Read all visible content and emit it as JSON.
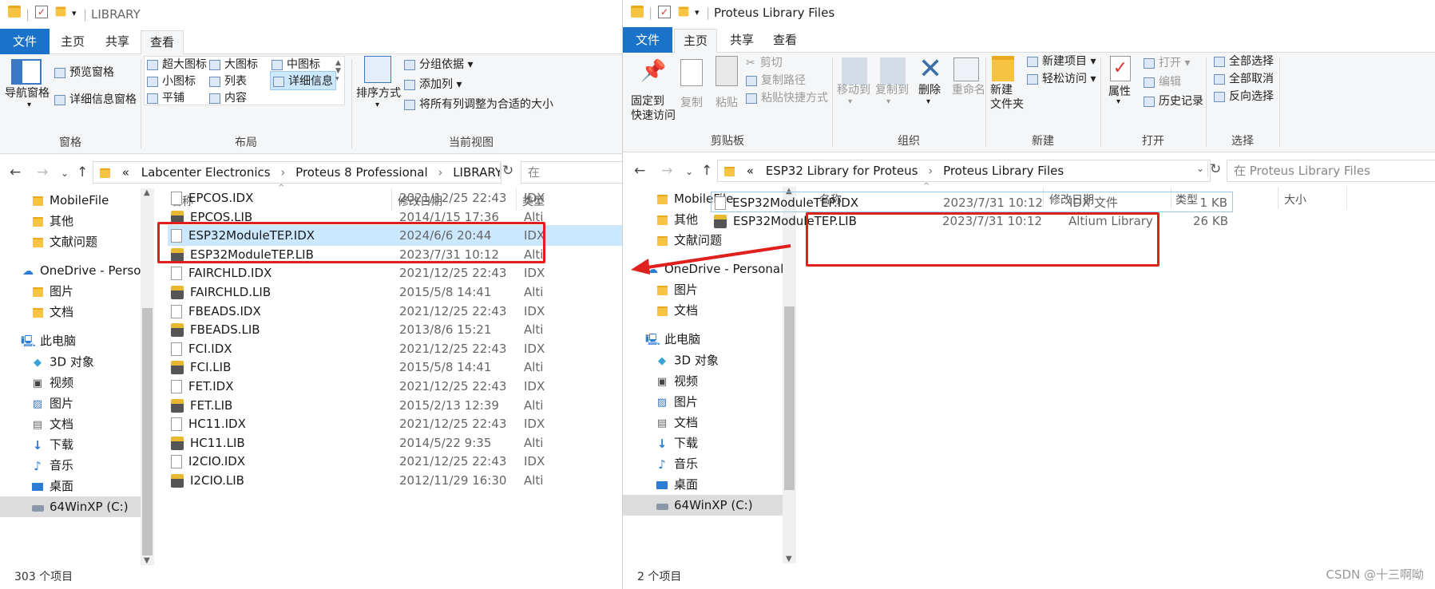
{
  "left": {
    "title": "LIBRARY",
    "tabs": [
      "文件",
      "主页",
      "共享",
      "查看"
    ],
    "ribbon": {
      "pane_nav": "导航窗格",
      "pane_preview": "预览窗格",
      "pane_details": "详细信息窗格",
      "group_panes": "窗格",
      "layout_items": [
        "超大图标",
        "大图标",
        "中图标",
        "小图标",
        "列表",
        "详细信息",
        "平铺",
        "内容"
      ],
      "group_layout": "布局",
      "sort": "排序方式",
      "group_by": "分组依据",
      "add_column": "添加列",
      "fit_columns": "将所有列调整为合适的大小",
      "group_view": "当前视图"
    },
    "path": [
      "«",
      "Labcenter Electronics",
      "Proteus 8 Professional",
      "LIBRARY"
    ],
    "search": "在",
    "nav": [
      {
        "label": "MobileFile",
        "icon": "folder"
      },
      {
        "label": "其他",
        "icon": "folder"
      },
      {
        "label": "文献问题",
        "icon": "folder"
      },
      {
        "label": "OneDrive - Personal",
        "icon": "cloud"
      },
      {
        "label": "图片",
        "icon": "folder"
      },
      {
        "label": "文档",
        "icon": "folder"
      },
      {
        "label": "此电脑",
        "icon": "pc"
      },
      {
        "label": "3D 对象",
        "icon": "cube"
      },
      {
        "label": "视频",
        "icon": "video"
      },
      {
        "label": "图片",
        "icon": "picture"
      },
      {
        "label": "文档",
        "icon": "doc"
      },
      {
        "label": "下载",
        "icon": "download"
      },
      {
        "label": "音乐",
        "icon": "music"
      },
      {
        "label": "桌面",
        "icon": "desktop"
      },
      {
        "label": "64WinXP  (C:)",
        "icon": "drive"
      }
    ],
    "columns": [
      "名称",
      "修改日期",
      "类型"
    ],
    "files": [
      {
        "name": "EPCOS.IDX",
        "date": "2021/12/25 22:43",
        "type": "IDX"
      },
      {
        "name": "EPCOS.LIB",
        "date": "2014/1/15 17:36",
        "type": "Alti"
      },
      {
        "name": "ESP32ModuleTEP.IDX",
        "date": "2024/6/6 20:44",
        "type": "IDX"
      },
      {
        "name": "ESP32ModuleTEP.LIB",
        "date": "2023/7/31 10:12",
        "type": "Alti"
      },
      {
        "name": "FAIRCHLD.IDX",
        "date": "2021/12/25 22:43",
        "type": "IDX"
      },
      {
        "name": "FAIRCHLD.LIB",
        "date": "2015/5/8 14:41",
        "type": "Alti"
      },
      {
        "name": "FBEADS.IDX",
        "date": "2021/12/25 22:43",
        "type": "IDX"
      },
      {
        "name": "FBEADS.LIB",
        "date": "2013/8/6 15:21",
        "type": "Alti"
      },
      {
        "name": "FCI.IDX",
        "date": "2021/12/25 22:43",
        "type": "IDX"
      },
      {
        "name": "FCI.LIB",
        "date": "2015/5/8 14:41",
        "type": "Alti"
      },
      {
        "name": "FET.IDX",
        "date": "2021/12/25 22:43",
        "type": "IDX"
      },
      {
        "name": "FET.LIB",
        "date": "2015/2/13 12:39",
        "type": "Alti"
      },
      {
        "name": "HC11.IDX",
        "date": "2021/12/25 22:43",
        "type": "IDX"
      },
      {
        "name": "HC11.LIB",
        "date": "2014/5/22 9:35",
        "type": "Alti"
      },
      {
        "name": "I2CIO.IDX",
        "date": "2021/12/25 22:43",
        "type": "IDX"
      },
      {
        "name": "I2CIO.LIB",
        "date": "2012/11/29 16:30",
        "type": "Alti"
      }
    ],
    "status": "303 个项目"
  },
  "right": {
    "title": "Proteus Library Files",
    "tabs": [
      "文件",
      "主页",
      "共享",
      "查看"
    ],
    "ribbon": {
      "pin": "固定到\n快速访问",
      "copy": "复制",
      "paste": "粘贴",
      "cut": "剪切",
      "copy_path": "复制路径",
      "paste_shortcut": "粘贴快捷方式",
      "group_clipboard": "剪贴板",
      "move_to": "移动到",
      "copy_to": "复制到",
      "delete": "删除",
      "rename": "重命名",
      "group_organize": "组织",
      "new_folder": "新建\n文件夹",
      "new_item": "新建项目",
      "easy_access": "轻松访问",
      "group_new": "新建",
      "properties": "属性",
      "open": "打开",
      "edit": "编辑",
      "history": "历史记录",
      "group_open": "打开",
      "select_all": "全部选择",
      "select_none": "全部取消",
      "invert": "反向选择",
      "group_select": "选择"
    },
    "path": [
      "«",
      "ESP32 Library for Proteus",
      "Proteus Library Files"
    ],
    "search": "在 Proteus Library Files",
    "nav": [
      {
        "label": "MobileFile",
        "icon": "folder"
      },
      {
        "label": "其他",
        "icon": "folder"
      },
      {
        "label": "文献问题",
        "icon": "folder"
      },
      {
        "label": "OneDrive - Personal",
        "icon": "cloud"
      },
      {
        "label": "图片",
        "icon": "folder"
      },
      {
        "label": "文档",
        "icon": "folder"
      },
      {
        "label": "此电脑",
        "icon": "pc"
      },
      {
        "label": "3D 对象",
        "icon": "cube"
      },
      {
        "label": "视频",
        "icon": "video"
      },
      {
        "label": "图片",
        "icon": "picture"
      },
      {
        "label": "文档",
        "icon": "doc"
      },
      {
        "label": "下载",
        "icon": "download"
      },
      {
        "label": "音乐",
        "icon": "music"
      },
      {
        "label": "桌面",
        "icon": "desktop"
      },
      {
        "label": "64WinXP  (C:)",
        "icon": "drive"
      }
    ],
    "columns": [
      "名称",
      "修改日期",
      "类型",
      "大小"
    ],
    "files": [
      {
        "name": "ESP32ModuleTEP.IDX",
        "date": "2023/7/31 10:12",
        "type": "IDX 文件",
        "size": "1 KB"
      },
      {
        "name": "ESP32ModuleTEP.LIB",
        "date": "2023/7/31 10:12",
        "type": "Altium Library",
        "size": "26 KB"
      }
    ],
    "status": "2 个项目"
  },
  "watermark": "CSDN @十三啊呦",
  "colors": {
    "accent": "#1a73c9",
    "selection": "#cce8ff",
    "highlight_box": "#e0201c"
  }
}
